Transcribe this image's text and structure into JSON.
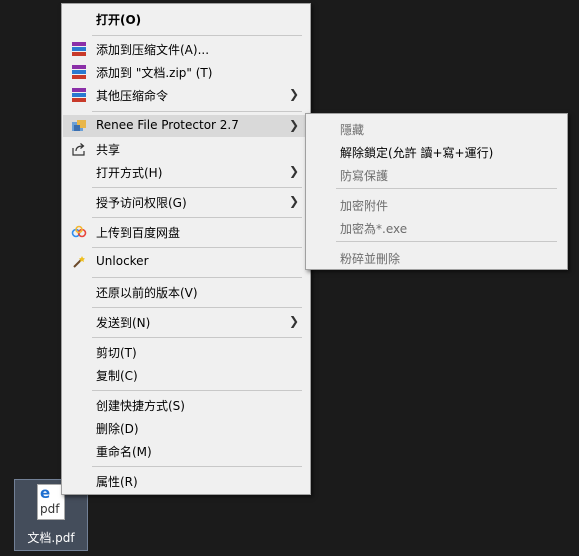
{
  "main_menu": {
    "open": "打开(O)",
    "add_archive": "添加到压缩文件(A)...",
    "add_zip": "添加到 \"文档.zip\" (T)",
    "other_compress": "其他压缩命令",
    "renee": "Renee File Protector 2.7",
    "share": "共享",
    "open_with": "打开方式(H)",
    "grant_access": "授予访问权限(G)",
    "baidu": "上传到百度网盘",
    "unlocker": "Unlocker",
    "restore": "还原以前的版本(V)",
    "send_to": "发送到(N)",
    "cut": "剪切(T)",
    "copy": "复制(C)",
    "shortcut": "创建快捷方式(S)",
    "delete": "删除(D)",
    "rename": "重命名(M)",
    "properties": "属性(R)"
  },
  "sub_menu": {
    "hide": "隱藏",
    "unlock": "解除鎖定(允許 讀+寫+運行)",
    "protect": "防寫保護",
    "encrypt_attach": "加密附件",
    "encrypt_exe": "加密為*.exe",
    "shred": "粉碎並刪除"
  },
  "desktop": {
    "file_icon_text": "pdf",
    "file_label": "文档.pdf"
  },
  "colors": {
    "menu_bg": "#f0f0f0",
    "hover_bg": "#d9d9d9",
    "disabled_text": "#6d6d6d",
    "desktop_bg": "#1b1b1b"
  }
}
